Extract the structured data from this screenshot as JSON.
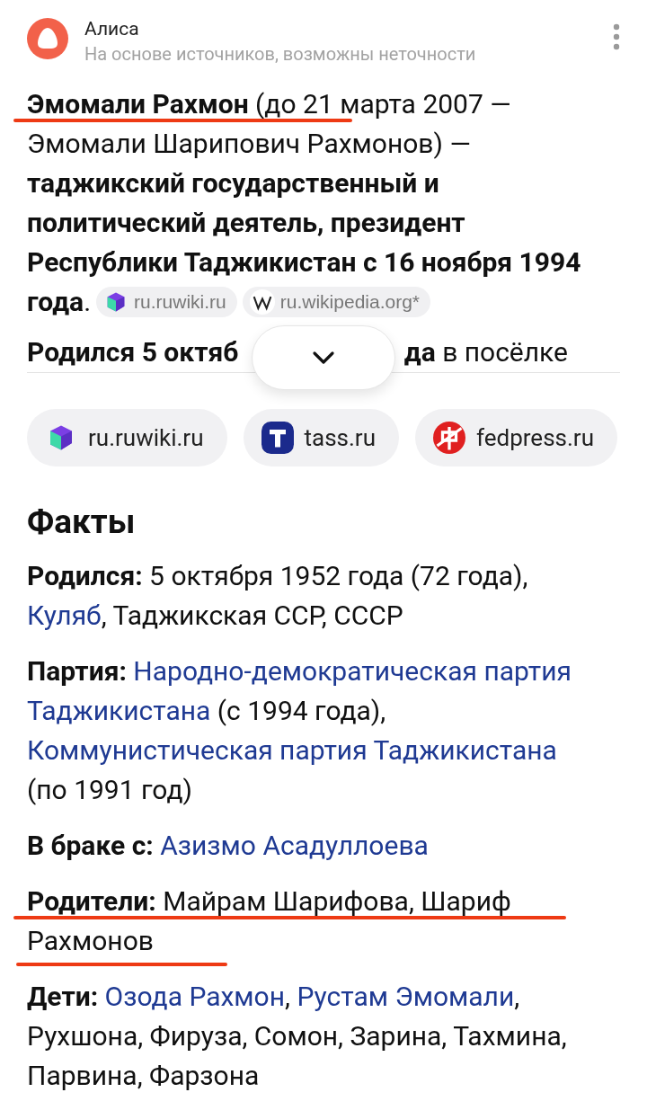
{
  "header": {
    "title": "Алиса",
    "subtitle": "На основе источников, возможны неточности"
  },
  "summary": {
    "text": "**Эмомали Рахмон** (до 21 марта 2007 — Эмомали Шарипович Рахмонов) — **таджикский государственный и политический деятель, президент Республики Таджикистан с 16 ноября 1994**",
    "tail": "**года**.",
    "marked": true,
    "citations": [
      {
        "label": "ru.ruwiki.ru",
        "kind": "ruwiki"
      },
      {
        "label": "ru.wikipedia.org*",
        "kind": "wikipedia"
      }
    ]
  },
  "truncated_line": {
    "before": "Родился 5 октяб",
    "after": "**да** в посёлке"
  },
  "sources": [
    {
      "label": "ru.ruwiki.ru",
      "kind": "ruwiki"
    },
    {
      "label": "tass.ru",
      "kind": "tass"
    },
    {
      "label": "fedpress.ru",
      "kind": "fedpress"
    }
  ],
  "facts": {
    "heading": "Факты",
    "items": [
      {
        "label": "Родился:",
        "parts": [
          {
            "text": "5 октября 1952 года (72 года), ",
            "link": false
          },
          {
            "text": "Куляб",
            "link": true
          },
          {
            "text": ", Таджикская ССР, СССР",
            "link": false
          }
        ]
      },
      {
        "label": "Партия:",
        "parts": [
          {
            "text": "Народно-демократическая партия",
            "link": true
          },
          {
            "text": "Таджикистана",
            "link": true
          },
          {
            "text": " (с 1994 года), ",
            "link": false
          },
          {
            "text": "Коммунистическая партия Таджикистана",
            "link": true
          },
          {
            "text": " (по 1991 год)",
            "link": false
          }
        ]
      },
      {
        "label": "В браке с:",
        "parts": [
          {
            "text": "Азизмо Асадуллоева",
            "link": true
          }
        ]
      },
      {
        "label": "Родители:",
        "marked": true,
        "parts": [
          {
            "text": "Майрам Шарифова, Шариф Рахмонов",
            "link": false
          }
        ]
      },
      {
        "label": "Дети:",
        "parts": [
          {
            "text": "Озода Рахмон",
            "link": true
          },
          {
            "text": ", ",
            "link": false
          },
          {
            "text": "Рустам Эмомали",
            "link": true
          },
          {
            "text": ", Рухшона, Фируза, Сомон, Зарина, Тахмина, Парвина, Фарзона",
            "link": false
          }
        ]
      }
    ]
  }
}
